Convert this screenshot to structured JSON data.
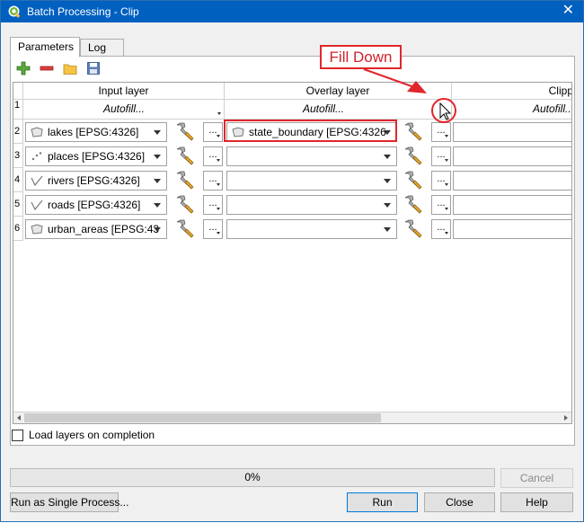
{
  "window": {
    "title": "Batch Processing - Clip",
    "close_glyph": "✕"
  },
  "tabs": [
    {
      "label": "Parameters"
    },
    {
      "label": "Log"
    }
  ],
  "toolbar": {
    "icons": [
      "add-row-icon",
      "remove-row-icon",
      "open-folder-icon",
      "save-icon"
    ]
  },
  "table": {
    "headers": [
      "Input layer",
      "Overlay layer",
      "Clipp"
    ],
    "autofill_label": "Autofill...",
    "rows": [
      {
        "num": "2",
        "input": "lakes [EPSG:4326]",
        "input_geom": "polygon",
        "overlay": "state_boundary [EPSG:4326"
      },
      {
        "num": "3",
        "input": "places [EPSG:4326]",
        "input_geom": "point",
        "overlay": ""
      },
      {
        "num": "4",
        "input": "rivers [EPSG:4326]",
        "input_geom": "line",
        "overlay": ""
      },
      {
        "num": "5",
        "input": "roads [EPSG:4326]",
        "input_geom": "line",
        "overlay": ""
      },
      {
        "num": "6",
        "input": "urban_areas [EPSG:43",
        "input_geom": "polygon",
        "overlay": ""
      }
    ],
    "autofill_row_num": "1",
    "dots_label": "..."
  },
  "annotation": {
    "label": "Fill Down",
    "color": "#e0262b"
  },
  "load_layers": {
    "label": "Load layers on completion",
    "checked": false
  },
  "progress": {
    "percent": 0,
    "label": "0%"
  },
  "buttons": {
    "cancel": "Cancel",
    "run_single": "Run as Single Process...",
    "run": "Run",
    "close": "Close",
    "help": "Help"
  }
}
